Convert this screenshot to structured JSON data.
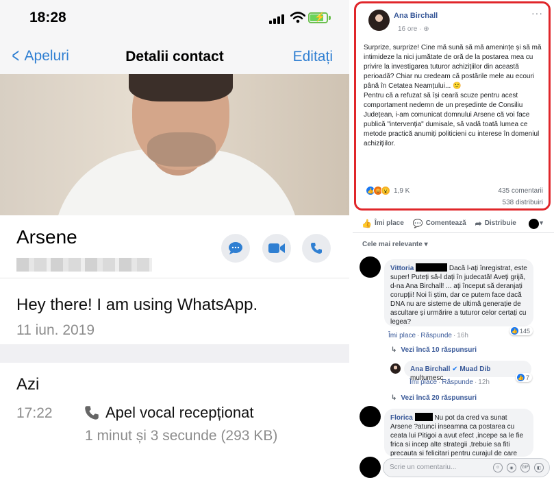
{
  "phone": {
    "status_bar": {
      "time": "18:28"
    },
    "nav": {
      "back_label": "Apeluri",
      "title": "Detalii contact",
      "edit_label": "Editați"
    },
    "contact": {
      "name": "Arsene",
      "phone_number_blurred": true
    },
    "about": {
      "text": "Hey there! I am using WhatsApp.",
      "date": "11 iun. 2019"
    },
    "calls": {
      "day": "Azi",
      "time": "17:22",
      "type": "Apel vocal recepționat",
      "duration": "1 minut și 3 secunde (293 KB)"
    },
    "colors": {
      "ios_blue": "#2f7fd2",
      "battery_green": "#6bd35a"
    }
  },
  "facebook": {
    "post": {
      "author": "Ana Birchall",
      "time_ago": "16 ore",
      "more": "···",
      "paragraph1": "Surprize, surprize! Cine mă sună să mă amenințe și să mă intimideze la nici jumătate de oră de la postarea mea cu privire la investigarea tuturor achizițiilor din această perioadă? Chiar nu credeam că postările mele au ecouri până în Cetatea Neamțului... 🙂",
      "paragraph2": "Pentru că a refuzat să își ceară scuze pentru acest comportament nedemn de un președinte de Consiliu Județean, i-am comunicat domnului Arsene că voi face publică \"intervenția\" dumisale, să vadă toată lumea ce metode practică anumiți politicieni cu interese în domeniul achizițiilor.",
      "reaction_count": "1,9 K",
      "comments": "435 comentarii",
      "shares": "538 distribuiri",
      "highlight_color": "#e0262a"
    },
    "actions": {
      "like": "Îmi place",
      "comment": "Comentează",
      "share": "Distribuie"
    },
    "sort": "Cele mai relevante ▾",
    "comments": [
      {
        "author": "Vittoria",
        "text": "Dacă l-ați înregistrat, este super! Puteți să-l dați în judecată! Aveți grijă, d-na Ana Birchall! ... ați început să deranjați corupții! Noi îi știm, dar ce putem face dacă DNA nu are sisteme de ultimă generație de ascultare și urmărire a tuturor celor certați cu legea?",
        "like": "Îmi place",
        "reply": "Răspunde",
        "ago": "16h",
        "likes": "145"
      },
      {
        "author": "Ana Birchall",
        "tag": "Muad Dib",
        "text": "multumesc",
        "like": "Îmi place",
        "reply": "Răspunde",
        "ago": "12h",
        "likes": "7"
      },
      {
        "author": "Florica",
        "text": "Nu pot da cred va sunat Arsene ?atunci inseamna ca postarea cu ceata lui Pitigoi a avut efect ,incepe sa le fie frica si incep alte strategii ,trebuie sa fiti precauta si felicitari pentru curajul de care"
      }
    ],
    "more_replies_1": "Vezi încă 10 răspunsuri",
    "more_replies_2": "Vezi încă 20 răspunsuri",
    "write_placeholder": "Scrie un comentariu...",
    "write_icons": [
      "emoji-icon",
      "camera-icon",
      "gif-icon",
      "sticker-icon"
    ]
  }
}
